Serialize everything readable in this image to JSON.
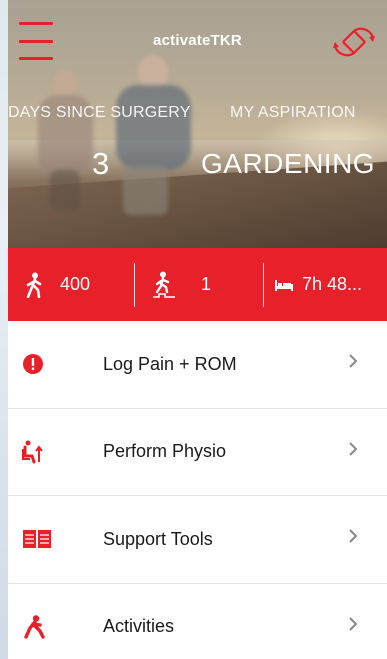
{
  "header": {
    "app_title": "activateTKR",
    "menu_icon": "hamburger-menu-icon",
    "sync_icon": "sync-icon"
  },
  "hero": {
    "days_label": "DAYS SINCE SURGERY",
    "days_value": "3",
    "aspiration_label": "MY ASPIRATION",
    "aspiration_value": "GARDENING"
  },
  "stats": [
    {
      "icon": "walking-person-icon",
      "value": "400"
    },
    {
      "icon": "stairs-climb-icon",
      "value": "1"
    },
    {
      "icon": "bed-icon",
      "value": "7h 48..."
    }
  ],
  "menu": [
    {
      "icon": "alert-icon",
      "label": "Log Pain + ROM"
    },
    {
      "icon": "physio-chair-icon",
      "label": "Perform Physio"
    },
    {
      "icon": "book-icon",
      "label": "Support Tools"
    },
    {
      "icon": "activity-person-icon",
      "label": "Activities"
    }
  ],
  "colors": {
    "accent": "#e8202a"
  }
}
